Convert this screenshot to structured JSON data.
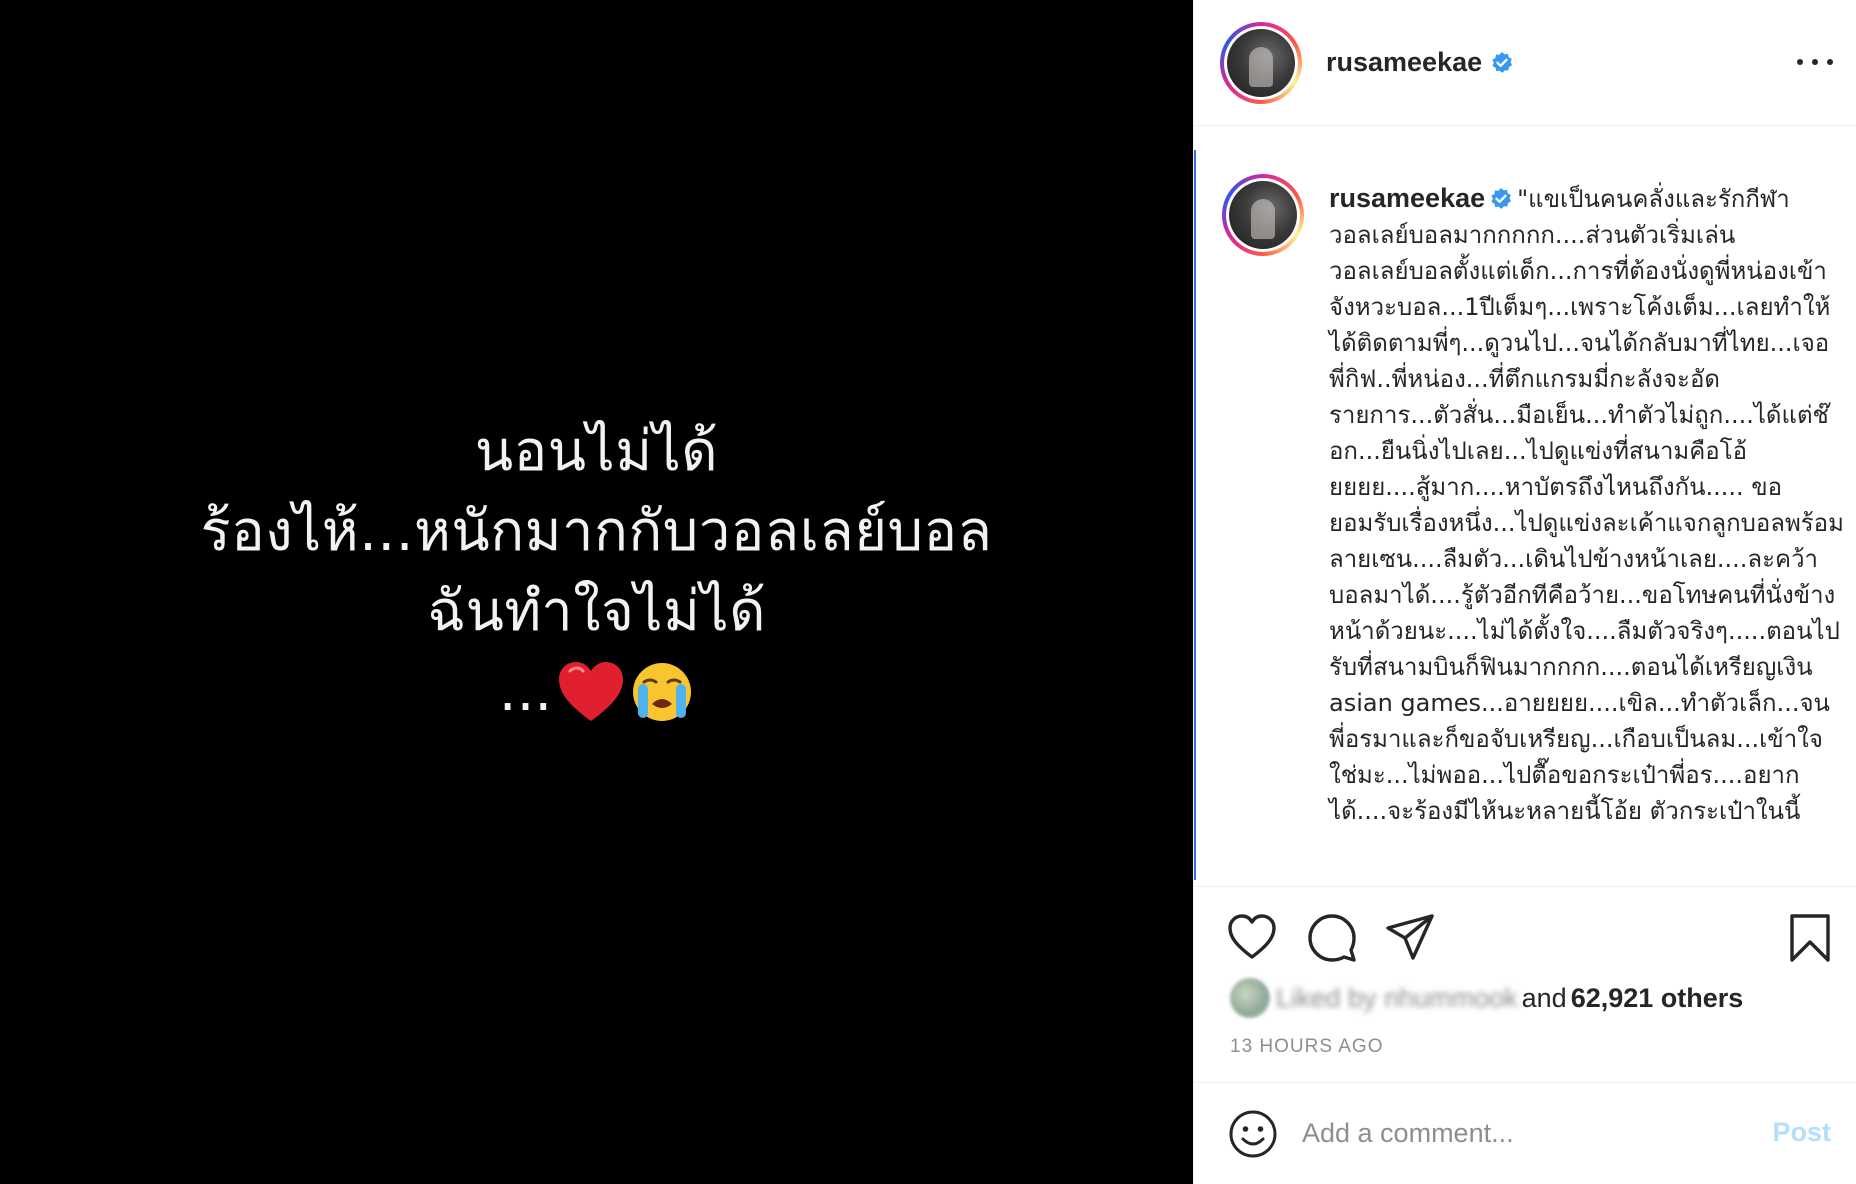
{
  "media": {
    "lines": [
      "นอนไม่ได้",
      "ร้องไห้...หนักมากกับวอลเลย์บอล",
      "ฉันทำใจไม่ได้"
    ],
    "emoji_prefix": "...",
    "emoji": [
      "red-heart-icon",
      "loudly-crying-face-icon"
    ],
    "background": "#000000"
  },
  "header": {
    "username": "rusameekae",
    "verified": true
  },
  "caption": {
    "username": "rusameekae",
    "text": "\"แขเป็นคนคลั่งและรักกีฬาวอลเลย์บอลมากกกกก....ส่วนตัวเริ่มเล่นวอลเลย์บอลตั้งแต่เด็ก...การที่ต้องนั่งดูพี่หน่องเข้าจังหวะบอล...1ปีเต็มๆ...เพราะโค้งเต็ม...เลยทำให้ได้ติดตามพี่ๆ...ดูวนไป...จนได้กลับมาที่ไทย...เจอพี่กิฟ..พี่หน่อง...ที่ตึกแกรมมี่กะลังจะอัดรายการ...ตัวสั่น...มือเย็น...ทำตัวไม่ถูก....ได้แต่ช๊อก...ยืนนิ่งไปเลย...ไปดูแข่งที่สนามคือโอ้ยยยย....สู้มาก....หาบัตรถึงไหนถึงกัน..... ขอยอมรับเรื่องหนึ่ง...ไปดูแข่งละเค้าแจกลูกบอลพร้อมลายเซน....ลืมตัว...เดินไปข้างหน้าเลย....ละคว้าบอลมาได้....รู้ตัวอีกทีคือว้าย...ขอโทษคนที่นั่งข้างหน้าด้วยนะ....ไม่ได้ตั้งใจ....ลืมตัวจริงๆ.....ตอนไปรับที่สนามบินก็ฟินมากกกก....ตอนได้เหรียญเงิน asian games...อายยยย....เขิล...ทำตัวเล็ก...จนพี่อรมาและก็ขอจับเหรียญ...เกือบเป็นลม...เข้าใจใช่มะ...ไม่พออ...ไปตื๊อขอกระเป๋าพี่อร....อยากได้....จะร้องมีไห้นะหลายนี้โอ้ย ตัวกระเป๋าในนี้"
  },
  "actions": {
    "like_icon": "heart-outline-icon",
    "comment_icon": "comment-icon",
    "share_icon": "share-icon",
    "save_icon": "bookmark-icon"
  },
  "likes": {
    "blurred_text": "Liked by nhummook",
    "and_text": "and",
    "count_text": "62,921 others"
  },
  "timestamp": "13 HOURS AGO",
  "comment": {
    "placeholder": "Add a comment...",
    "post_label": "Post"
  },
  "colors": {
    "verified_blue": "#3897f0",
    "post_disabled": "#b2dffc",
    "muted_text": "#8e8e8e"
  }
}
